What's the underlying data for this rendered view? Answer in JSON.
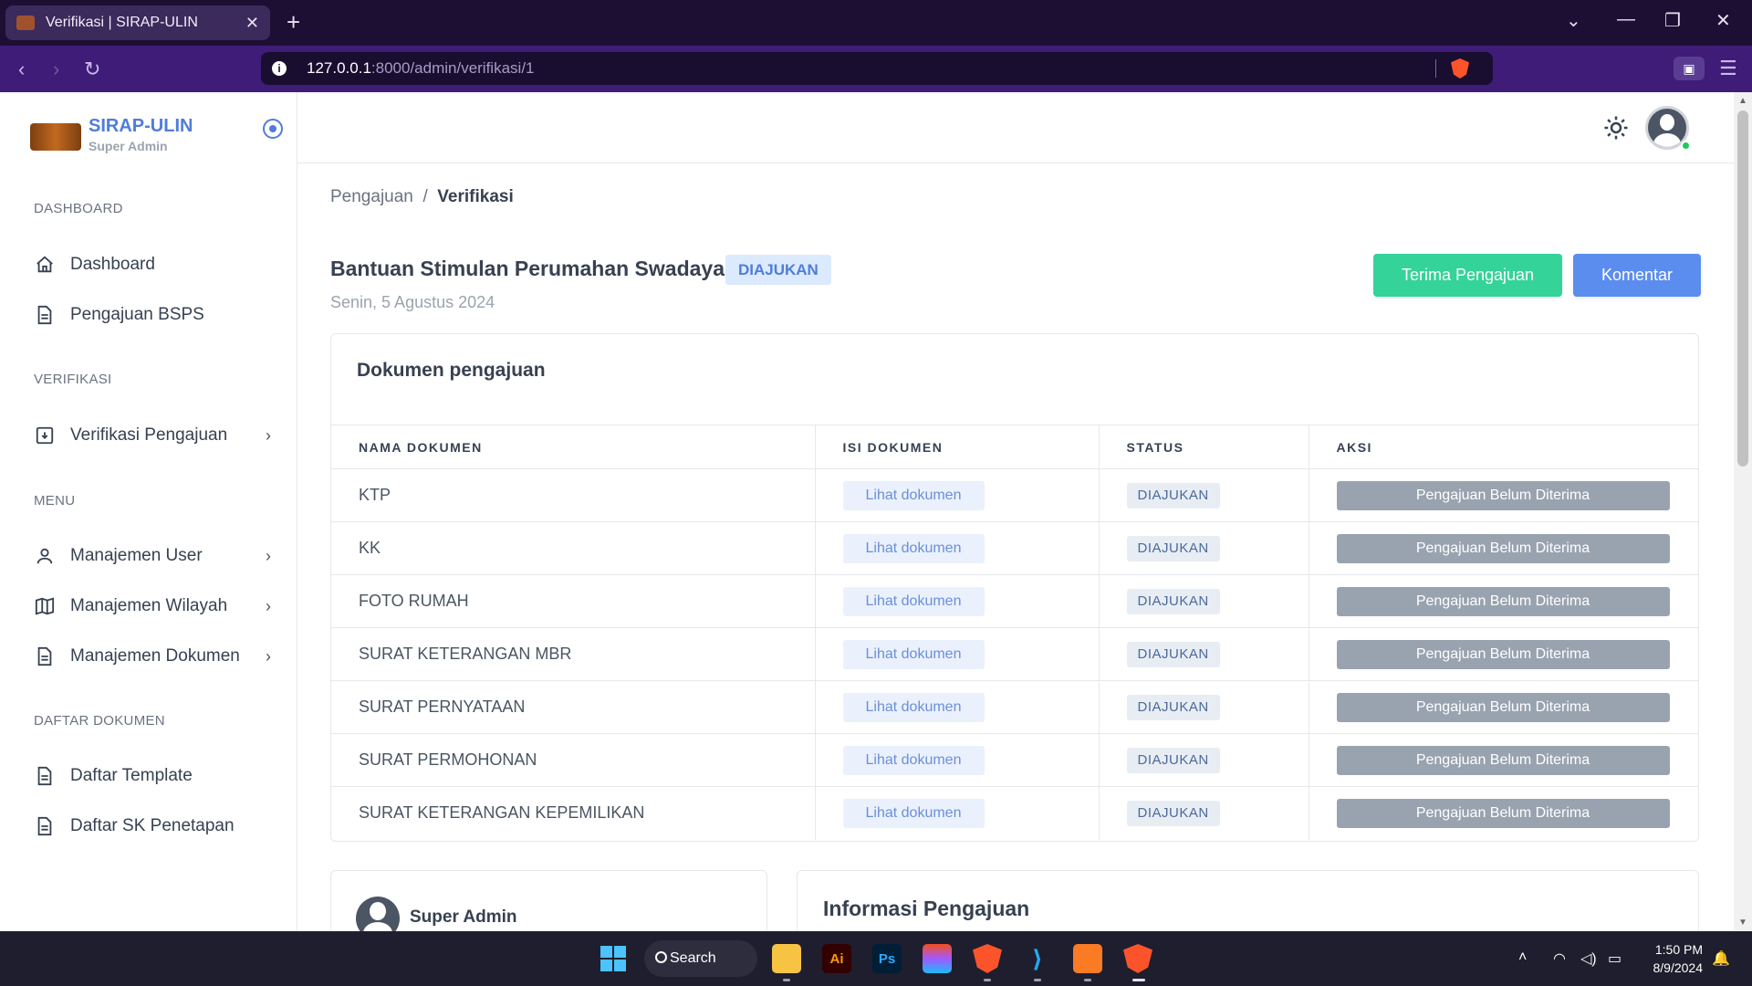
{
  "browser": {
    "tab_title": "Verifikasi | SIRAP-ULIN",
    "tab_close": "✕",
    "new_tab": "+",
    "url_host": "127.0.0.1",
    "url_path": ":8000/admin/verifikasi/1"
  },
  "sidebar": {
    "brand": "SIRAP-ULIN",
    "role": "Super Admin",
    "sections": [
      {
        "heading": "DASHBOARD",
        "items": [
          {
            "label": "Dashboard"
          },
          {
            "label": "Pengajuan BSPS"
          }
        ]
      },
      {
        "heading": "VERIFIKASI",
        "items": [
          {
            "label": "Verifikasi Pengajuan"
          }
        ]
      },
      {
        "heading": "MENU",
        "items": [
          {
            "label": "Manajemen User"
          },
          {
            "label": "Manajemen Wilayah"
          },
          {
            "label": "Manajemen Dokumen"
          }
        ]
      },
      {
        "heading": "DAFTAR DOKUMEN",
        "items": [
          {
            "label": "Daftar Template"
          },
          {
            "label": "Daftar SK Penetapan"
          }
        ]
      }
    ]
  },
  "breadcrumb": {
    "parent": "Pengajuan",
    "separator": "/",
    "current": "Verifikasi"
  },
  "header": {
    "title": "Bantuan Stimulan Perumahan Swadaya",
    "status": "DIAJUKAN",
    "date": "Senin, 5 Agustus 2024",
    "accept_button": "Terima Pengajuan",
    "comment_button": "Komentar"
  },
  "documents": {
    "title": "Dokumen pengajuan",
    "columns": [
      "NAMA DOKUMEN",
      "ISI DOKUMEN",
      "STATUS",
      "AKSI"
    ],
    "rows": [
      {
        "name": "KTP",
        "link": "Lihat dokumen",
        "status": "DIAJUKAN",
        "action": "Pengajuan Belum Diterima"
      },
      {
        "name": "KK",
        "link": "Lihat dokumen",
        "status": "DIAJUKAN",
        "action": "Pengajuan Belum Diterima"
      },
      {
        "name": "FOTO RUMAH",
        "link": "Lihat dokumen",
        "status": "DIAJUKAN",
        "action": "Pengajuan Belum Diterima"
      },
      {
        "name": "SURAT KETERANGAN MBR",
        "link": "Lihat dokumen",
        "status": "DIAJUKAN",
        "action": "Pengajuan Belum Diterima"
      },
      {
        "name": "SURAT PERNYATAAN",
        "link": "Lihat dokumen",
        "status": "DIAJUKAN",
        "action": "Pengajuan Belum Diterima"
      },
      {
        "name": "SURAT PERMOHONAN",
        "link": "Lihat dokumen",
        "status": "DIAJUKAN",
        "action": "Pengajuan Belum Diterima"
      },
      {
        "name": "SURAT KETERANGAN KEPEMILIKAN",
        "link": "Lihat dokumen",
        "status": "DIAJUKAN",
        "action": "Pengajuan Belum Diterima"
      }
    ]
  },
  "applicant_card": {
    "name": "Super Admin"
  },
  "info_card": {
    "title": "Informasi Pengajuan"
  },
  "taskbar": {
    "search_label": "Search",
    "apps": [
      {
        "name": "file-explorer",
        "label": "",
        "color": "#f6c343"
      },
      {
        "name": "illustrator",
        "label": "Ai",
        "color": "#ff9a00"
      },
      {
        "name": "photoshop",
        "label": "Ps",
        "color": "#31a8ff"
      },
      {
        "name": "figma",
        "label": "",
        "color": "#a259ff"
      },
      {
        "name": "brave-nightly",
        "label": "",
        "color": "#fb542b"
      },
      {
        "name": "vscode",
        "label": "",
        "color": "#23a9f2"
      },
      {
        "name": "xampp",
        "label": "",
        "color": "#fb7a24"
      },
      {
        "name": "brave",
        "label": "",
        "color": "#fb542b"
      }
    ],
    "time": "1:50 PM",
    "date": "8/9/2024"
  },
  "colors": {
    "brand": "#4f7dd9",
    "accept": "#34d399",
    "comment": "#5b8def",
    "disabled": "#99a3b0"
  }
}
